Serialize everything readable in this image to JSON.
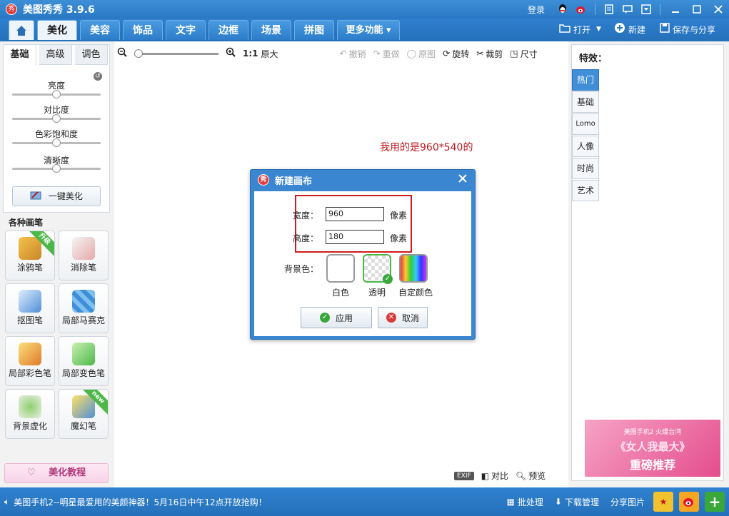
{
  "app": {
    "title": "美图秀秀 3.9.6",
    "logo_glyph": "秀"
  },
  "titlebar": {
    "login": "登录",
    "icons": [
      "qq-icon",
      "weibo-icon",
      "doc-icon",
      "message-icon",
      "skin-icon"
    ]
  },
  "tabs": [
    {
      "label": "美化",
      "active": true
    },
    {
      "label": "美容"
    },
    {
      "label": "饰品"
    },
    {
      "label": "文字"
    },
    {
      "label": "边框"
    },
    {
      "label": "场景"
    },
    {
      "label": "拼图"
    },
    {
      "label": "更多功能 ▾"
    }
  ],
  "toolbar_right": {
    "open": "打开",
    "new": "新建",
    "save_share": "保存与分享"
  },
  "adjust": {
    "tabs": [
      "基础",
      "高级",
      "调色"
    ],
    "sliders": [
      {
        "label": "亮度",
        "value": 0.5
      },
      {
        "label": "对比度",
        "value": 0.5
      },
      {
        "label": "色彩饱和度",
        "value": 0.5
      },
      {
        "label": "清晰度",
        "value": 0.5
      }
    ],
    "onekey": "一键美化"
  },
  "brushes": {
    "title": "各种画笔",
    "items": [
      {
        "label": "涂鸦笔",
        "ribbon": "升级"
      },
      {
        "label": "消除笔"
      },
      {
        "label": "抠图笔"
      },
      {
        "label": "局部马赛克"
      },
      {
        "label": "局部彩色笔"
      },
      {
        "label": "局部变色笔"
      },
      {
        "label": "背景虚化"
      },
      {
        "label": "魔幻笔",
        "ribbon": "new"
      }
    ]
  },
  "tutorial": "美化教程",
  "canvas_toolbar": {
    "zoom_ratio": "1:1",
    "original_size": "原大",
    "undo": "撤销",
    "redo": "重做",
    "original": "原图",
    "rotate": "旋转",
    "crop": "裁剪",
    "size": "尺寸"
  },
  "canvas_note": "我用的是960*540的",
  "dialog": {
    "title": "新建画布",
    "width_label": "宽度：",
    "width_value": "960",
    "height_label": "高度：",
    "height_value": "180",
    "unit": "像素",
    "bg_label": "背景色：",
    "swatches": [
      "白色",
      "透明",
      "自定颜色"
    ],
    "apply": "应用",
    "cancel": "取消"
  },
  "effects": {
    "title": "特效：",
    "categories": [
      "热门",
      "基础",
      "Lomo",
      "人像",
      "时尚",
      "艺术"
    ]
  },
  "ad": {
    "line1": "美图手机2 火爆台湾",
    "line2": "《女人我最大》",
    "line3": "重磅推荐"
  },
  "bottom_tools": {
    "exif": "EXIF",
    "compare": "对比",
    "preview": "预览"
  },
  "statusbar": {
    "message": "美图手机2--明星最爱用的美颜神器！5月16日中午12点开放抢购！",
    "batch": "批处理",
    "download": "下载管理",
    "share": "分享图片"
  },
  "colors": {
    "brand_blue": "#2a78c4",
    "note_red": "#c0181e",
    "frame_red": "#d11a1a"
  }
}
